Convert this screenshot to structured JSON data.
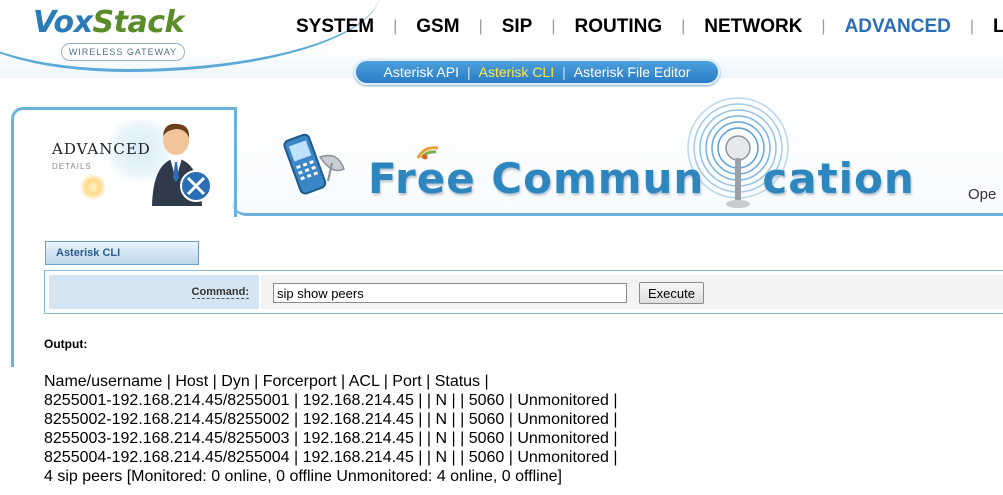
{
  "brand": {
    "name_part1": "Vox",
    "name_part2": "Stack",
    "tagline": "WIRELESS GATEWAY"
  },
  "nav": {
    "items": [
      {
        "label": "SYSTEM"
      },
      {
        "label": "GSM"
      },
      {
        "label": "SIP"
      },
      {
        "label": "ROUTING"
      },
      {
        "label": "NETWORK"
      },
      {
        "label": "ADVANCED",
        "active": true
      },
      {
        "label": "LOGS"
      }
    ],
    "separator": "|"
  },
  "subnav": {
    "items": [
      {
        "label": "Asterisk API"
      },
      {
        "label": "Asterisk CLI",
        "active": true
      },
      {
        "label": "Asterisk File Editor"
      }
    ],
    "separator": "|"
  },
  "section": {
    "title": "ADVANCED",
    "subtitle": "DETAILS"
  },
  "banner": {
    "text_part1": "Free Commun",
    "text_part2": "cation",
    "edge_text": "Ope"
  },
  "cli": {
    "tab_label": "Asterisk CLI",
    "command_label": "Command:",
    "command_value": "sip show peers",
    "execute_label": "Execute",
    "output_label": "Output:",
    "output_lines": [
      "Name/username | Host | Dyn | Forcerport | ACL | Port | Status |",
      "8255001-192.168.214.45/8255001 | 192.168.214.45 | | N | | 5060 | Unmonitored |",
      "8255002-192.168.214.45/8255002 | 192.168.214.45 | | N | | 5060 | Unmonitored |",
      "8255003-192.168.214.45/8255003 | 192.168.214.45 | | N | | 5060 | Unmonitored |",
      "8255004-192.168.214.45/8255004 | 192.168.214.45 | | N | | 5060 | Unmonitored |",
      "4 sip peers [Monitored: 0 online, 0 offline Unmonitored: 4 online, 0 offline]"
    ]
  },
  "colors": {
    "accent": "#2a6fb5",
    "subnav_active": "#ffe84a",
    "border": "#6db2dd"
  }
}
